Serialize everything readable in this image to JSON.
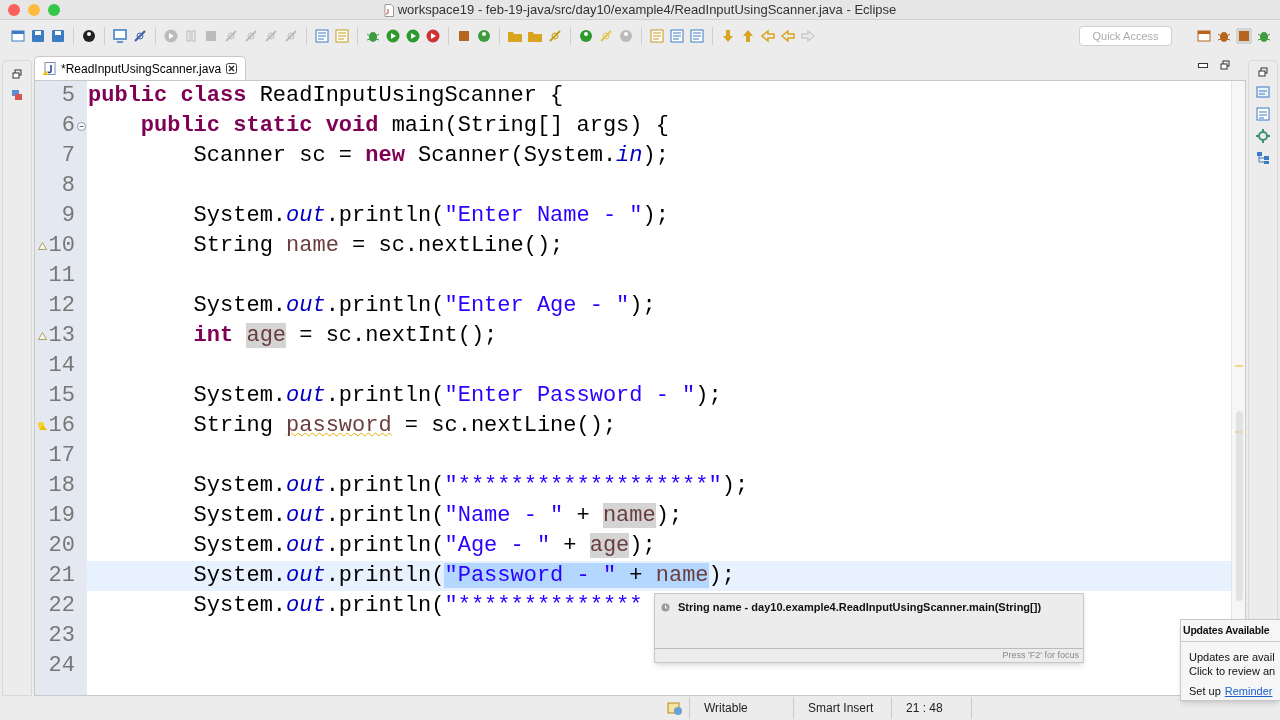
{
  "window": {
    "title": "workspace19 - feb-19-java/src/day10/example4/ReadInputUsingScanner.java - Eclipse"
  },
  "toolbar": {
    "quick_access": {
      "placeholder": "Quick Access"
    }
  },
  "editor_tab": {
    "label": "*ReadInputUsingScanner.java",
    "selected": true
  },
  "editor": {
    "lines": [
      {
        "number": "5",
        "kind": "plain",
        "tokens": [
          {
            "kind": "keyword",
            "text": "public class"
          },
          {
            "kind": "plain",
            "text": " ReadInputUsingScanner {"
          }
        ]
      },
      {
        "number": "6",
        "kind": "fold",
        "tokens": [
          {
            "kind": "keyword",
            "text": "    public static void"
          },
          {
            "kind": "plain",
            "text": " main(String[] args) {"
          }
        ]
      },
      {
        "number": "7",
        "kind": "plain",
        "tokens": [
          {
            "kind": "plain",
            "text": "        Scanner sc = "
          },
          {
            "kind": "keyword",
            "text": "new"
          },
          {
            "kind": "plain",
            "text": " Scanner(System."
          },
          {
            "kind": "field",
            "text": "in"
          },
          {
            "kind": "plain",
            "text": ");"
          }
        ]
      },
      {
        "number": "8",
        "kind": "plain"
      },
      {
        "number": "9",
        "kind": "plain",
        "tokens": [
          {
            "kind": "plain",
            "text": "        System."
          },
          {
            "kind": "field",
            "text": "out"
          },
          {
            "kind": "plain",
            "text": ".println("
          },
          {
            "kind": "string",
            "text": "\"Enter Name - \""
          },
          {
            "kind": "plain",
            "text": ");"
          }
        ]
      },
      {
        "number": "10",
        "kind": "warning",
        "tokens": [
          {
            "kind": "plain",
            "text": "        String "
          },
          {
            "kind": "local",
            "text": "name"
          },
          {
            "kind": "plain",
            "text": " = sc.nextLine();"
          }
        ]
      },
      {
        "number": "11",
        "kind": "plain"
      },
      {
        "number": "12",
        "kind": "plain",
        "tokens": [
          {
            "kind": "plain",
            "text": "        System."
          },
          {
            "kind": "field",
            "text": "out"
          },
          {
            "kind": "plain",
            "text": ".println("
          },
          {
            "kind": "string",
            "text": "\"Enter Age - \""
          },
          {
            "kind": "plain",
            "text": ");"
          }
        ]
      },
      {
        "number": "13",
        "kind": "warning",
        "tokens": [
          {
            "kind": "keyword",
            "text": "        int "
          },
          {
            "kind": "occurrence",
            "text": "age"
          },
          {
            "kind": "plain",
            "text": " = sc.nextInt();"
          }
        ]
      },
      {
        "number": "14",
        "kind": "plain"
      },
      {
        "number": "15",
        "kind": "plain",
        "tokens": [
          {
            "kind": "plain",
            "text": "        System."
          },
          {
            "kind": "field",
            "text": "out"
          },
          {
            "kind": "plain",
            "text": ".println("
          },
          {
            "kind": "string",
            "text": "\"Enter Password - \""
          },
          {
            "kind": "plain",
            "text": ");"
          }
        ]
      },
      {
        "number": "16",
        "kind": "quickfix",
        "tokens": [
          {
            "kind": "plain",
            "text": "        String "
          },
          {
            "kind": "squiggle",
            "text": "password"
          },
          {
            "kind": "plain",
            "text": " = sc.nextLine();"
          }
        ]
      },
      {
        "number": "17",
        "kind": "plain"
      },
      {
        "number": "18",
        "kind": "plain",
        "tokens": [
          {
            "kind": "plain",
            "text": "        System."
          },
          {
            "kind": "field",
            "text": "out"
          },
          {
            "kind": "plain",
            "text": ".println("
          },
          {
            "kind": "string",
            "text": "\"*******************\""
          },
          {
            "kind": "plain",
            "text": ");"
          }
        ]
      },
      {
        "number": "19",
        "kind": "plain",
        "tokens": [
          {
            "kind": "plain",
            "text": "        System."
          },
          {
            "kind": "field",
            "text": "out"
          },
          {
            "kind": "plain",
            "text": ".println("
          },
          {
            "kind": "string",
            "text": "\"Name - \""
          },
          {
            "kind": "plain",
            "text": " + "
          },
          {
            "kind": "occurrence",
            "text": "name"
          },
          {
            "kind": "plain",
            "text": ");"
          }
        ]
      },
      {
        "number": "20",
        "kind": "plain",
        "tokens": [
          {
            "kind": "plain",
            "text": "        System."
          },
          {
            "kind": "field",
            "text": "out"
          },
          {
            "kind": "plain",
            "text": ".println("
          },
          {
            "kind": "string",
            "text": "\"Age - \""
          },
          {
            "kind": "plain",
            "text": " + "
          },
          {
            "kind": "occurrence",
            "text": "age"
          },
          {
            "kind": "plain",
            "text": ");"
          }
        ]
      },
      {
        "number": "21",
        "kind": "plain",
        "current": true,
        "tokens": [
          {
            "kind": "plain",
            "text": "        System."
          },
          {
            "kind": "field",
            "text": "out"
          },
          {
            "kind": "plain",
            "text": ".println("
          },
          {
            "kind": "selstring",
            "text": "\"Password - \""
          },
          {
            "kind": "selplain",
            "text": " + "
          },
          {
            "kind": "sellocal",
            "text": "name"
          },
          {
            "kind": "plain",
            "text": ");"
          }
        ]
      },
      {
        "number": "22",
        "kind": "plain",
        "tokens": [
          {
            "kind": "plain",
            "text": "        System."
          },
          {
            "kind": "field",
            "text": "out"
          },
          {
            "kind": "plain",
            "text": ".println("
          },
          {
            "kind": "string",
            "text": "\"**************"
          }
        ]
      },
      {
        "number": "23",
        "kind": "plain"
      },
      {
        "number": "24",
        "kind": "plain"
      }
    ]
  },
  "hover_tooltip": {
    "text": "String name - day10.example4.ReadInputUsingScanner.main(String[])",
    "footer": "Press 'F2' for focus"
  },
  "updates_popup": {
    "title": "Updates Available",
    "lines": [
      "Updates are avail",
      "Click to review an"
    ],
    "prefix": "Set up",
    "link": "Reminder"
  },
  "status_bar": {
    "items": [
      "Writable",
      "Smart Insert",
      "21 : 48"
    ]
  }
}
